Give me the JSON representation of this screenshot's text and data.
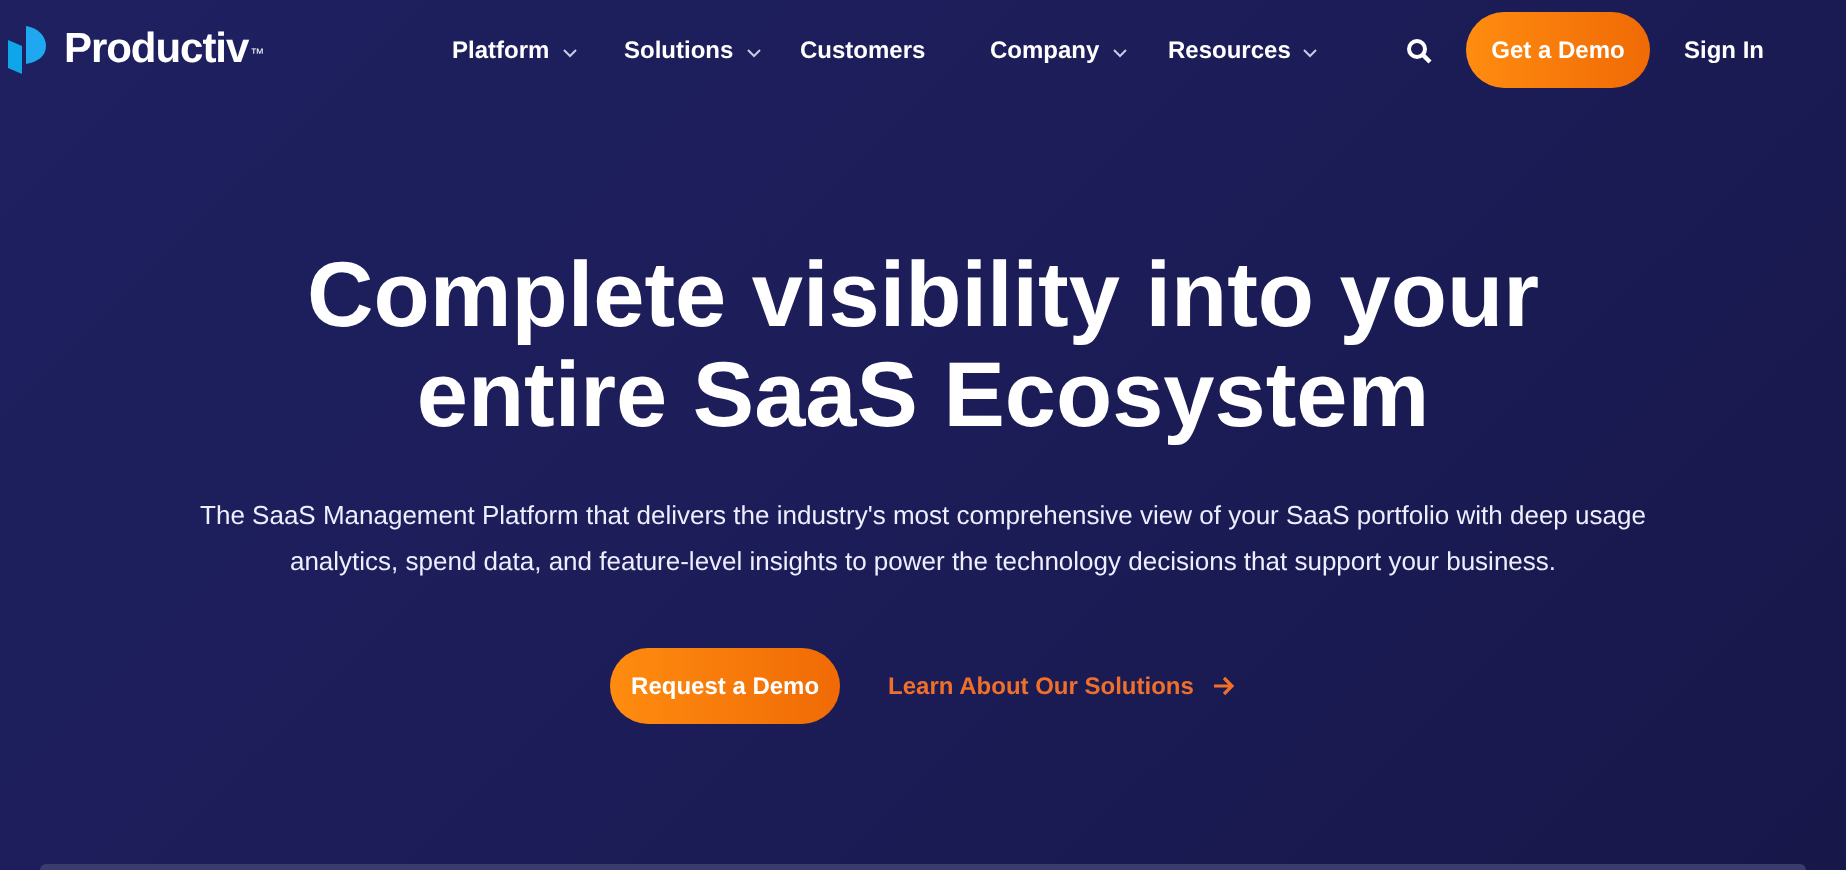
{
  "logo": {
    "text": "Productiv",
    "trademark": "™"
  },
  "nav": [
    {
      "label": "Platform",
      "dropdown": true
    },
    {
      "label": "Solutions",
      "dropdown": true
    },
    {
      "label": "Customers",
      "dropdown": false
    },
    {
      "label": "Company",
      "dropdown": true
    },
    {
      "label": "Resources",
      "dropdown": true
    }
  ],
  "header_actions": {
    "demo_button": "Get a Demo",
    "sign_in": "Sign In"
  },
  "hero": {
    "title_lines": [
      "Complete visibility into your",
      "entire SaaS Ecosystem"
    ],
    "subtitle": "The SaaS Management Platform that delivers the industry's most comprehensive view of your SaaS portfolio with deep usage analytics, spend data, and feature-level insights to power the technology decisions that support your business.",
    "primary_button": "Request a Demo",
    "secondary_link": "Learn About Our Solutions"
  }
}
